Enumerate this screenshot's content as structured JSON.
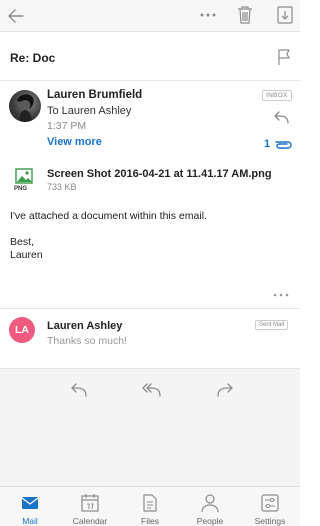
{
  "toolbar": {
    "icons": [
      "back-arrow-icon",
      "more-icon",
      "trash-icon",
      "archive-icon"
    ]
  },
  "subject": "Re: Doc",
  "message": {
    "sender": "Lauren Brumfield",
    "to": "To Lauren Ashley",
    "time": "1:37 PM",
    "view_more": "View more",
    "folder_badge": "INBOX",
    "attachment_count": "1",
    "attachment": {
      "name": "Screen Shot 2016-04-21 at 11.41.17 AM.png",
      "type": "PNG",
      "size": "733 KB"
    },
    "body": [
      "I've attached a document within this email.",
      "",
      "Best,",
      "Lauren"
    ]
  },
  "reply": {
    "initials": "LA",
    "sender": "Lauren Ashley",
    "preview": "Thanks so much!",
    "badge": "Sent Mail",
    "avatar_color": "#ef5a7e"
  },
  "tabs": [
    {
      "label": "Mail",
      "active": true
    },
    {
      "label": "Calendar",
      "active": false
    },
    {
      "label": "Files",
      "active": false
    },
    {
      "label": "People",
      "active": false
    },
    {
      "label": "Settings",
      "active": false
    }
  ],
  "colors": {
    "accent": "#1a73c8",
    "icon": "#9a9a9a"
  }
}
